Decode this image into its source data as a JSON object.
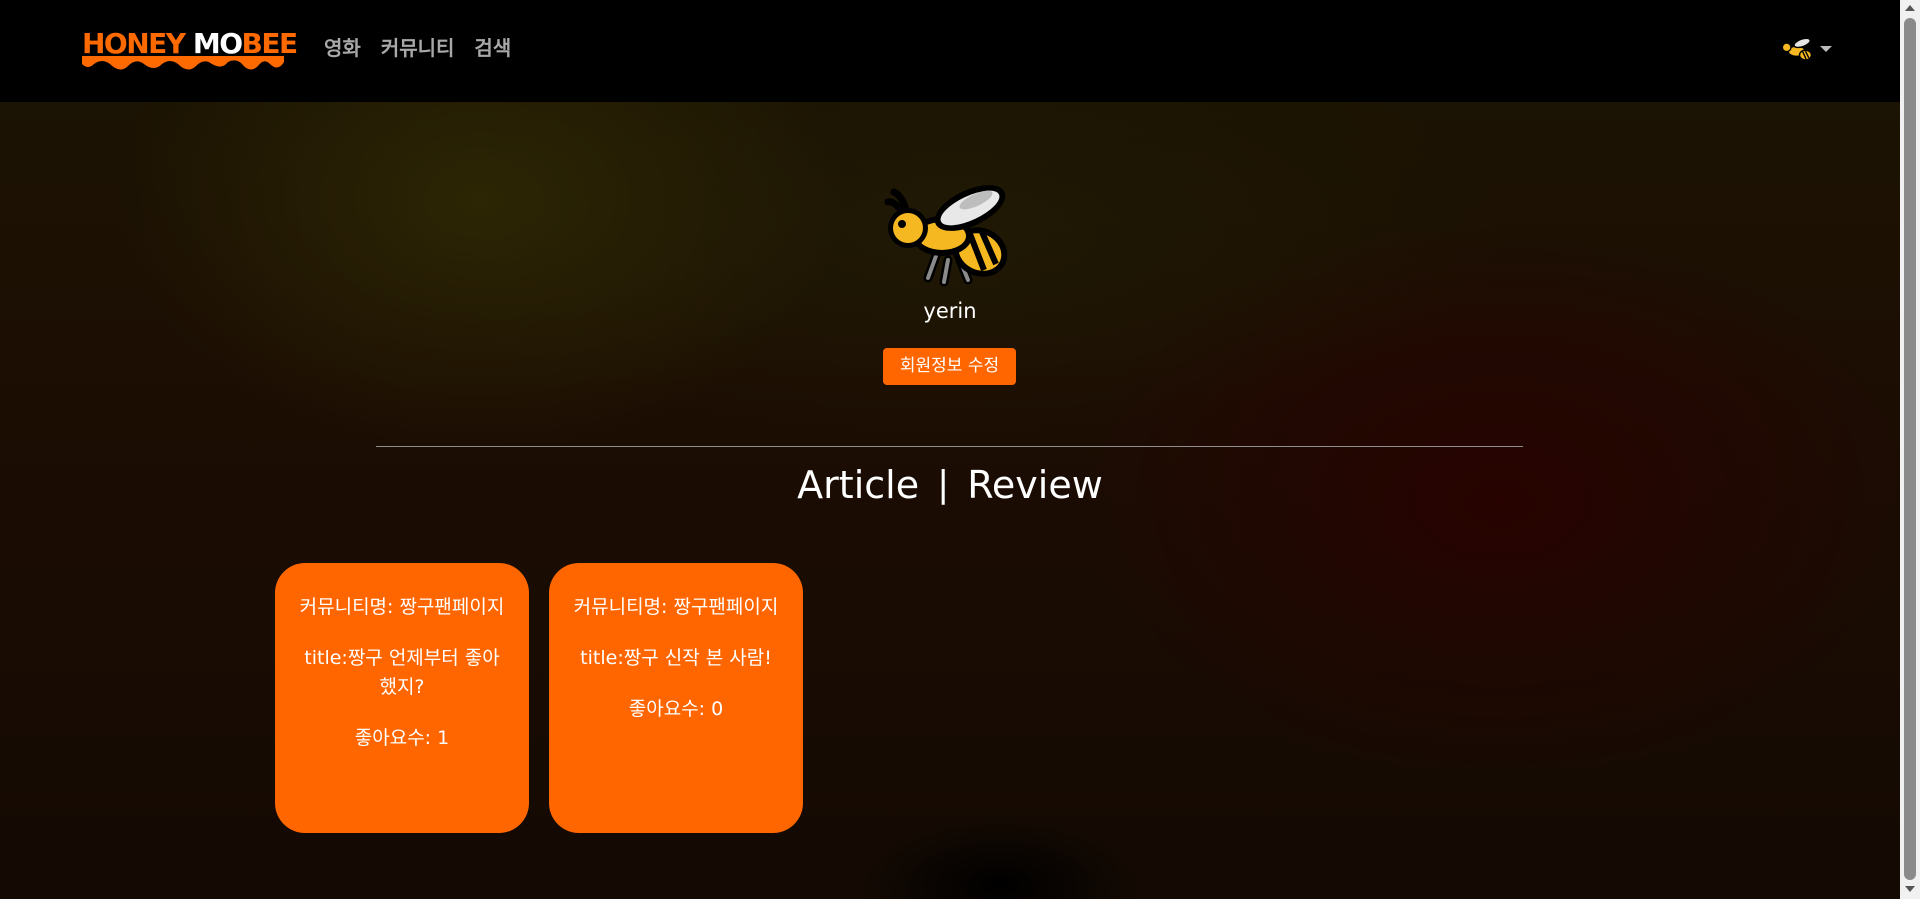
{
  "navbar": {
    "logo": {
      "part1": "HONEY ",
      "part2": "MO",
      "part3": "BEE"
    },
    "links": [
      "영화",
      "커뮤니티",
      "검색"
    ],
    "user_icon": "bee-icon"
  },
  "profile": {
    "avatar_icon": "bee-icon",
    "username": "yerin",
    "edit_button": "회원정보 수정"
  },
  "tabs": {
    "article": "Article",
    "separator": "|",
    "review": "Review"
  },
  "articles": [
    {
      "community": "커뮤니티명: 짱구팬페이지",
      "title": "title:짱구 언제부터 좋아했지?",
      "likes": "좋아요수: 1"
    },
    {
      "community": "커뮤니티명: 짱구팬페이지",
      "title": "title:짱구 신작 본 사람!",
      "likes": "좋아요수: 0"
    }
  ],
  "colors": {
    "accent": "#ff6600",
    "navbar": "#000000"
  }
}
